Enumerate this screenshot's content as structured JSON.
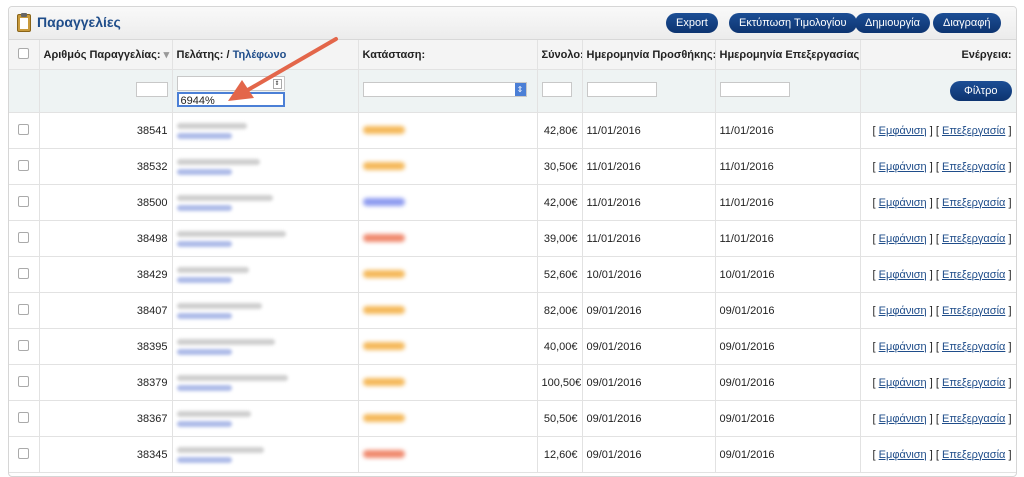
{
  "header": {
    "title": "Παραγγελίες",
    "buttons": {
      "export": "Export",
      "print_invoice": "Εκτύπωση Τιμολογίου",
      "create": "Δημιουργία",
      "delete": "Διαγραφή"
    }
  },
  "table": {
    "columns": {
      "order_number": "Αριθμός Παραγγελίας:",
      "customer": "Πελάτης: /",
      "phone": "Τηλέφωνο",
      "status": "Κατάσταση:",
      "total": "Σύνολο:",
      "date_added": "Ημερομηνία Προσθήκης:",
      "date_processed": "Ημερομηνία Επεξεργασίας:",
      "actions": "Ενέργεια:"
    },
    "filter": {
      "phone_value": "6944%",
      "filter_button": "Φίλτρο"
    },
    "actions": {
      "view": "Εμφάνιση",
      "edit": "Επεξεργασία",
      "bracket_open": "[",
      "bracket_close": "]"
    },
    "rows": [
      {
        "id": "38541",
        "total": "42,80€",
        "date_added": "11/01/2016",
        "date_processed": "11/01/2016"
      },
      {
        "id": "38532",
        "total": "30,50€",
        "date_added": "11/01/2016",
        "date_processed": "11/01/2016"
      },
      {
        "id": "38500",
        "total": "42,00€",
        "date_added": "11/01/2016",
        "date_processed": "11/01/2016"
      },
      {
        "id": "38498",
        "total": "39,00€",
        "date_added": "11/01/2016",
        "date_processed": "11/01/2016"
      },
      {
        "id": "38429",
        "total": "52,60€",
        "date_added": "10/01/2016",
        "date_processed": "10/01/2016"
      },
      {
        "id": "38407",
        "total": "82,00€",
        "date_added": "09/01/2016",
        "date_processed": "09/01/2016"
      },
      {
        "id": "38395",
        "total": "40,00€",
        "date_added": "09/01/2016",
        "date_processed": "09/01/2016"
      },
      {
        "id": "38379",
        "total": "100,50€",
        "date_added": "09/01/2016",
        "date_processed": "09/01/2016"
      },
      {
        "id": "38367",
        "total": "50,50€",
        "date_added": "09/01/2016",
        "date_processed": "09/01/2016"
      },
      {
        "id": "38345",
        "total": "12,60€",
        "date_added": "09/01/2016",
        "date_processed": "09/01/2016"
      }
    ],
    "status_colors": [
      "#f5b95a",
      "#f5b95a",
      "#8e9bf0",
      "#f08a6e",
      "#f5b95a",
      "#f5b95a",
      "#f5b95a",
      "#f5b95a",
      "#f5b95a",
      "#f08a6e"
    ]
  },
  "colors": {
    "brand": "#1f4d8a",
    "button": "#123f80",
    "arrow": "#e3664a"
  },
  "icons": {
    "header": "clipboard-icon",
    "select": "chevron-updown-icon",
    "annotation": "red-arrow-icon"
  }
}
